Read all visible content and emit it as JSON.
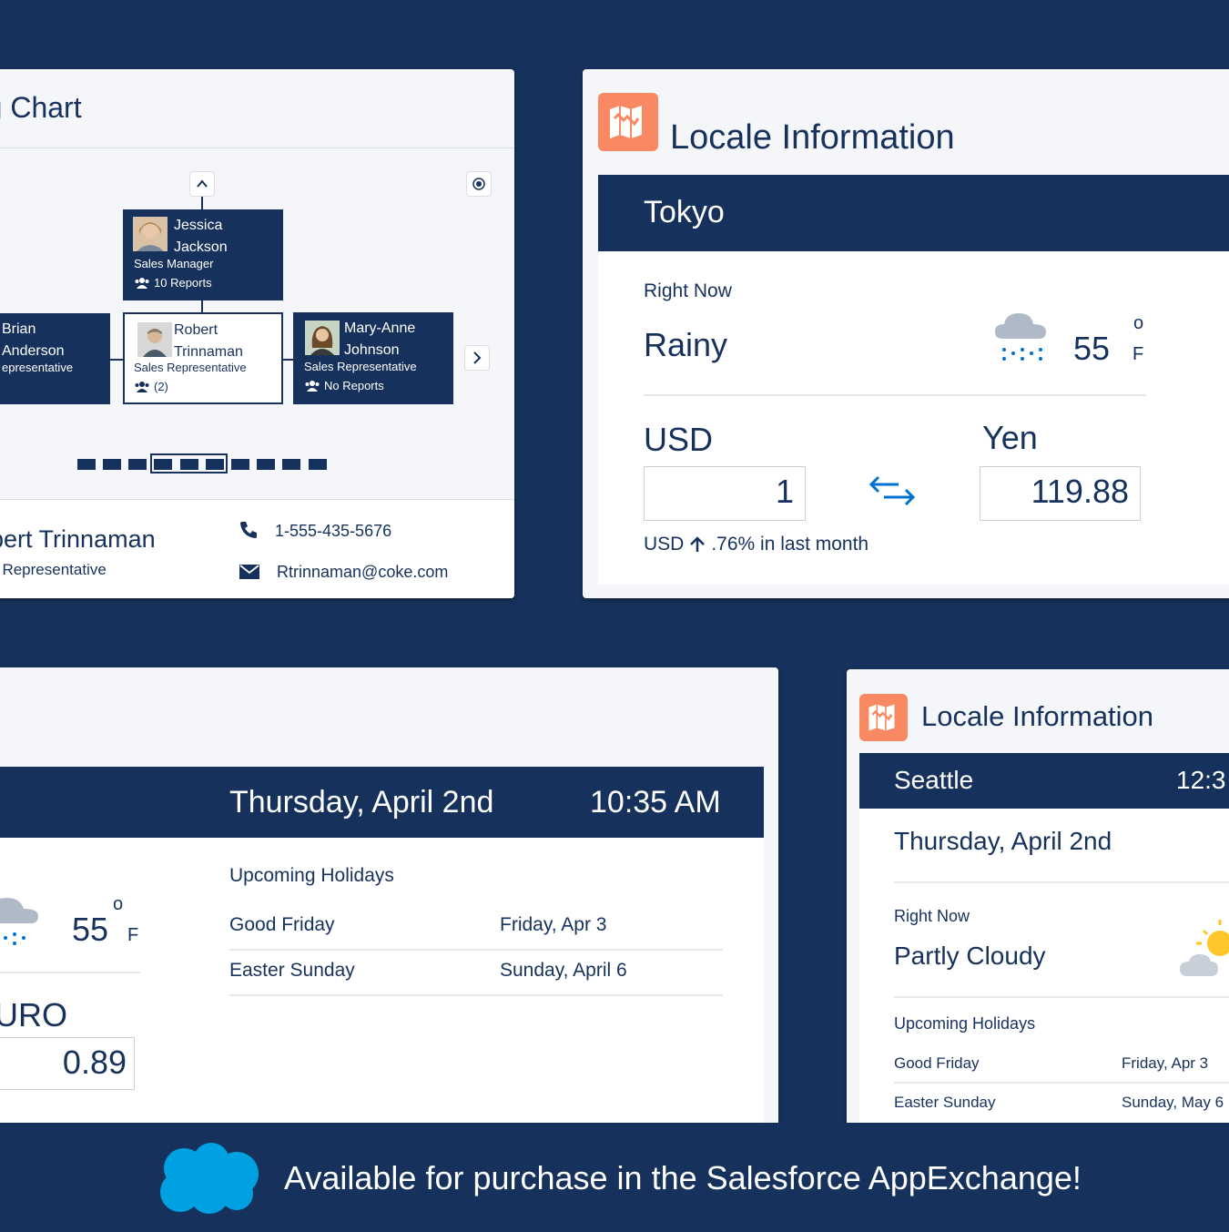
{
  "org_chart": {
    "title": "rg Chart",
    "top_node": {
      "first": "Jessica",
      "last": "Jackson",
      "role": "Sales Manager",
      "reports": "10 Reports"
    },
    "left_node": {
      "first": "Brian",
      "last": "Anderson",
      "role": "epresentative"
    },
    "mid_node": {
      "first": "Robert",
      "last": "Trinnaman",
      "role": "Sales Representative",
      "reports": "(2)"
    },
    "right_node": {
      "first": "Mary-Anne",
      "last": "Johnson",
      "role": "Sales Representative",
      "reports": "No Reports"
    },
    "footer": {
      "name": "obert Trinnaman",
      "role": "les Representative",
      "phone": "1-555-435-5676",
      "email": "Rtrinnaman@coke.com"
    }
  },
  "locale_tokyo": {
    "title": "Locale Information",
    "city": "Tokyo",
    "right_now_label": "Right Now",
    "condition": "Rainy",
    "temp": "55",
    "degree": "o",
    "unit": "F",
    "from_currency": "USD",
    "to_currency": "Yen",
    "from_value": "1",
    "to_value": "119.88",
    "trend_prefix": "USD",
    "trend_text": ".76% in last month"
  },
  "holidays_card": {
    "date": "Thursday, April 2nd",
    "time": "10:35 AM",
    "temp": "55",
    "degree": "o",
    "unit": "F",
    "currency": "EURO",
    "currency_value": "0.89",
    "holidays_label": "Upcoming Holidays",
    "holidays": [
      {
        "name": "Good Friday",
        "date": "Friday, Apr 3"
      },
      {
        "name": "Easter Sunday",
        "date": "Sunday, April 6"
      }
    ]
  },
  "locale_seattle": {
    "title": "Locale Information",
    "city": "Seattle",
    "time": "12:3",
    "date": "Thursday, April 2nd",
    "right_now_label": "Right Now",
    "condition": "Partly Cloudy",
    "holidays_label": "Upcoming Holidays",
    "holidays": [
      {
        "name": "Good Friday",
        "date": "Friday, Apr 3"
      },
      {
        "name": "Easter Sunday",
        "date": "Sunday, May 6"
      }
    ]
  },
  "banner": {
    "text": "Available for purchase in the Salesforce AppExchange!"
  },
  "colors": {
    "navy": "#16325c",
    "orange": "#f88962",
    "blue": "#0070d2",
    "sf_blue": "#00a1e0"
  }
}
